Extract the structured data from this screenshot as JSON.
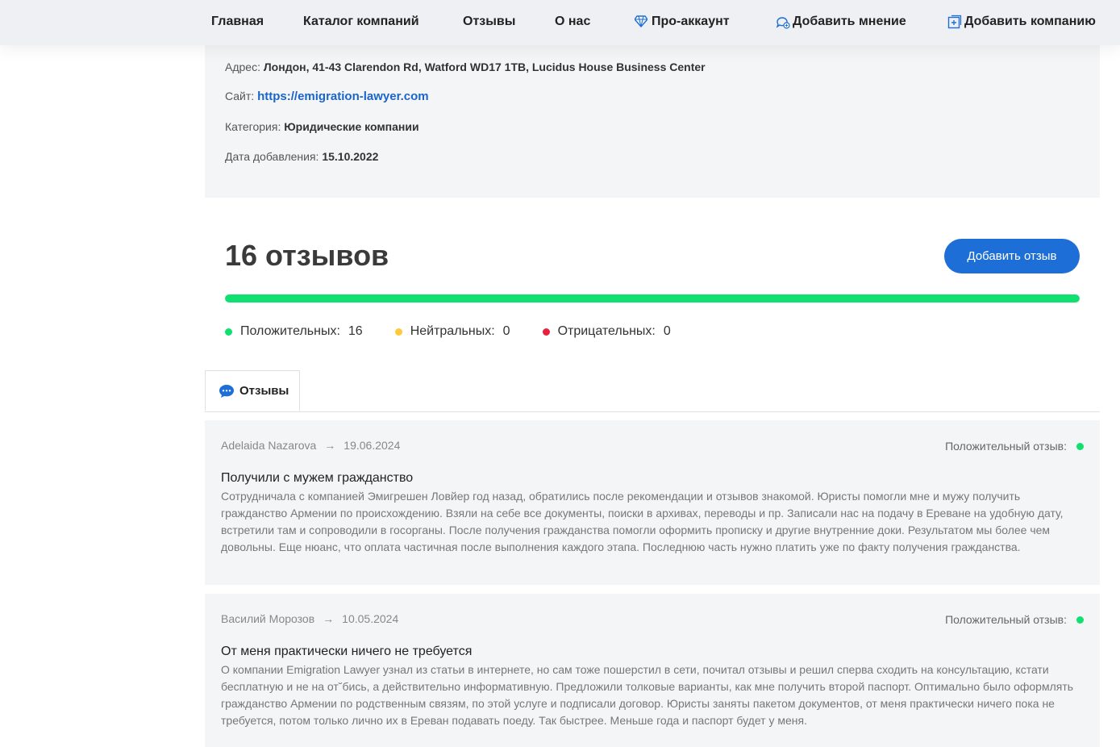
{
  "nav": {
    "home": "Главная",
    "catalog": "Каталог компаний",
    "reviews": "Отзывы",
    "about": "О нас",
    "pro": "Про-аккаунт",
    "add_opinion": "Добавить мнение",
    "add_company": "Добавить компанию"
  },
  "company": {
    "address_label": "Адрес:",
    "address": "Лондон, 41-43 Clarendon Rd, Watford WD17 1TB, Lucidus House Business Center",
    "site_label": "Сайт:",
    "site": "https://emigration-lawyer.com",
    "category_label": "Категория:",
    "category": "Юридические компании",
    "date_label": "Дата добавления:",
    "date": "15.10.2022"
  },
  "reviews_summary": {
    "title": "16 отзывов",
    "add_button": "Добавить отзыв",
    "positive_fraction": 1.0,
    "positive_label": "Положительных:",
    "positive_count": "16",
    "neutral_label": "Нейтральных:",
    "neutral_count": "0",
    "negative_label": "Отрицательных:",
    "negative_count": "0",
    "colors": {
      "positive": "#0fe06f",
      "neutral": "#ffc93a",
      "negative": "#e8213f"
    }
  },
  "tabs": {
    "reviews": "Отзывы"
  },
  "reviews": [
    {
      "author": "Adelaida Nazarova",
      "arrow": "→",
      "date": "19.06.2024",
      "type": "Положительный отзыв:",
      "title": "Получили с мужем гражданство",
      "text": "Сотрудничала с компанией Эмигрешен Ловйер год назад, обратились после рекомендации и отзывов знакомой. Юристы помогли мне и мужу получить гражданство Армении по происхождению. Взяли на себе все документы, поиски в архивах, переводы и пр. Записали нас на подачу в Ереване на удобную дату, встретили там и сопроводили в госорганы. После получения гражданства помогли оформить прописку и другие внутренние доки. Результатом мы более чем довольны. Еще нюанс, что оплата частичная после выполнения каждого этапа. Последнюю часть нужно платить уже по факту получения гражданства."
    },
    {
      "author": "Василий Морозов",
      "arrow": "→",
      "date": "10.05.2024",
      "type": "Положительный отзыв:",
      "title": "От меня практически ничего не требуется",
      "text": "О компании Emigration Lawyer узнал из статьи в интернете, но сам тоже пошерстил в сети, почитал отзывы и решил сперва сходить на консультацию, кстати бесплатную и не на от˘бись, а действительно информативную. Предложили толковые варианты, как мне получить второй паспорт. Оптимально было оформлять гражданство Армении по родственным связям, по этой услуге и подписали договор. Юристы заняты пакетом документов, от меня практически ничего пока не требуется, потом только лично их в Ереван подавать поеду. Так быстрее. Меньше года и паспорт будет у меня."
    }
  ]
}
